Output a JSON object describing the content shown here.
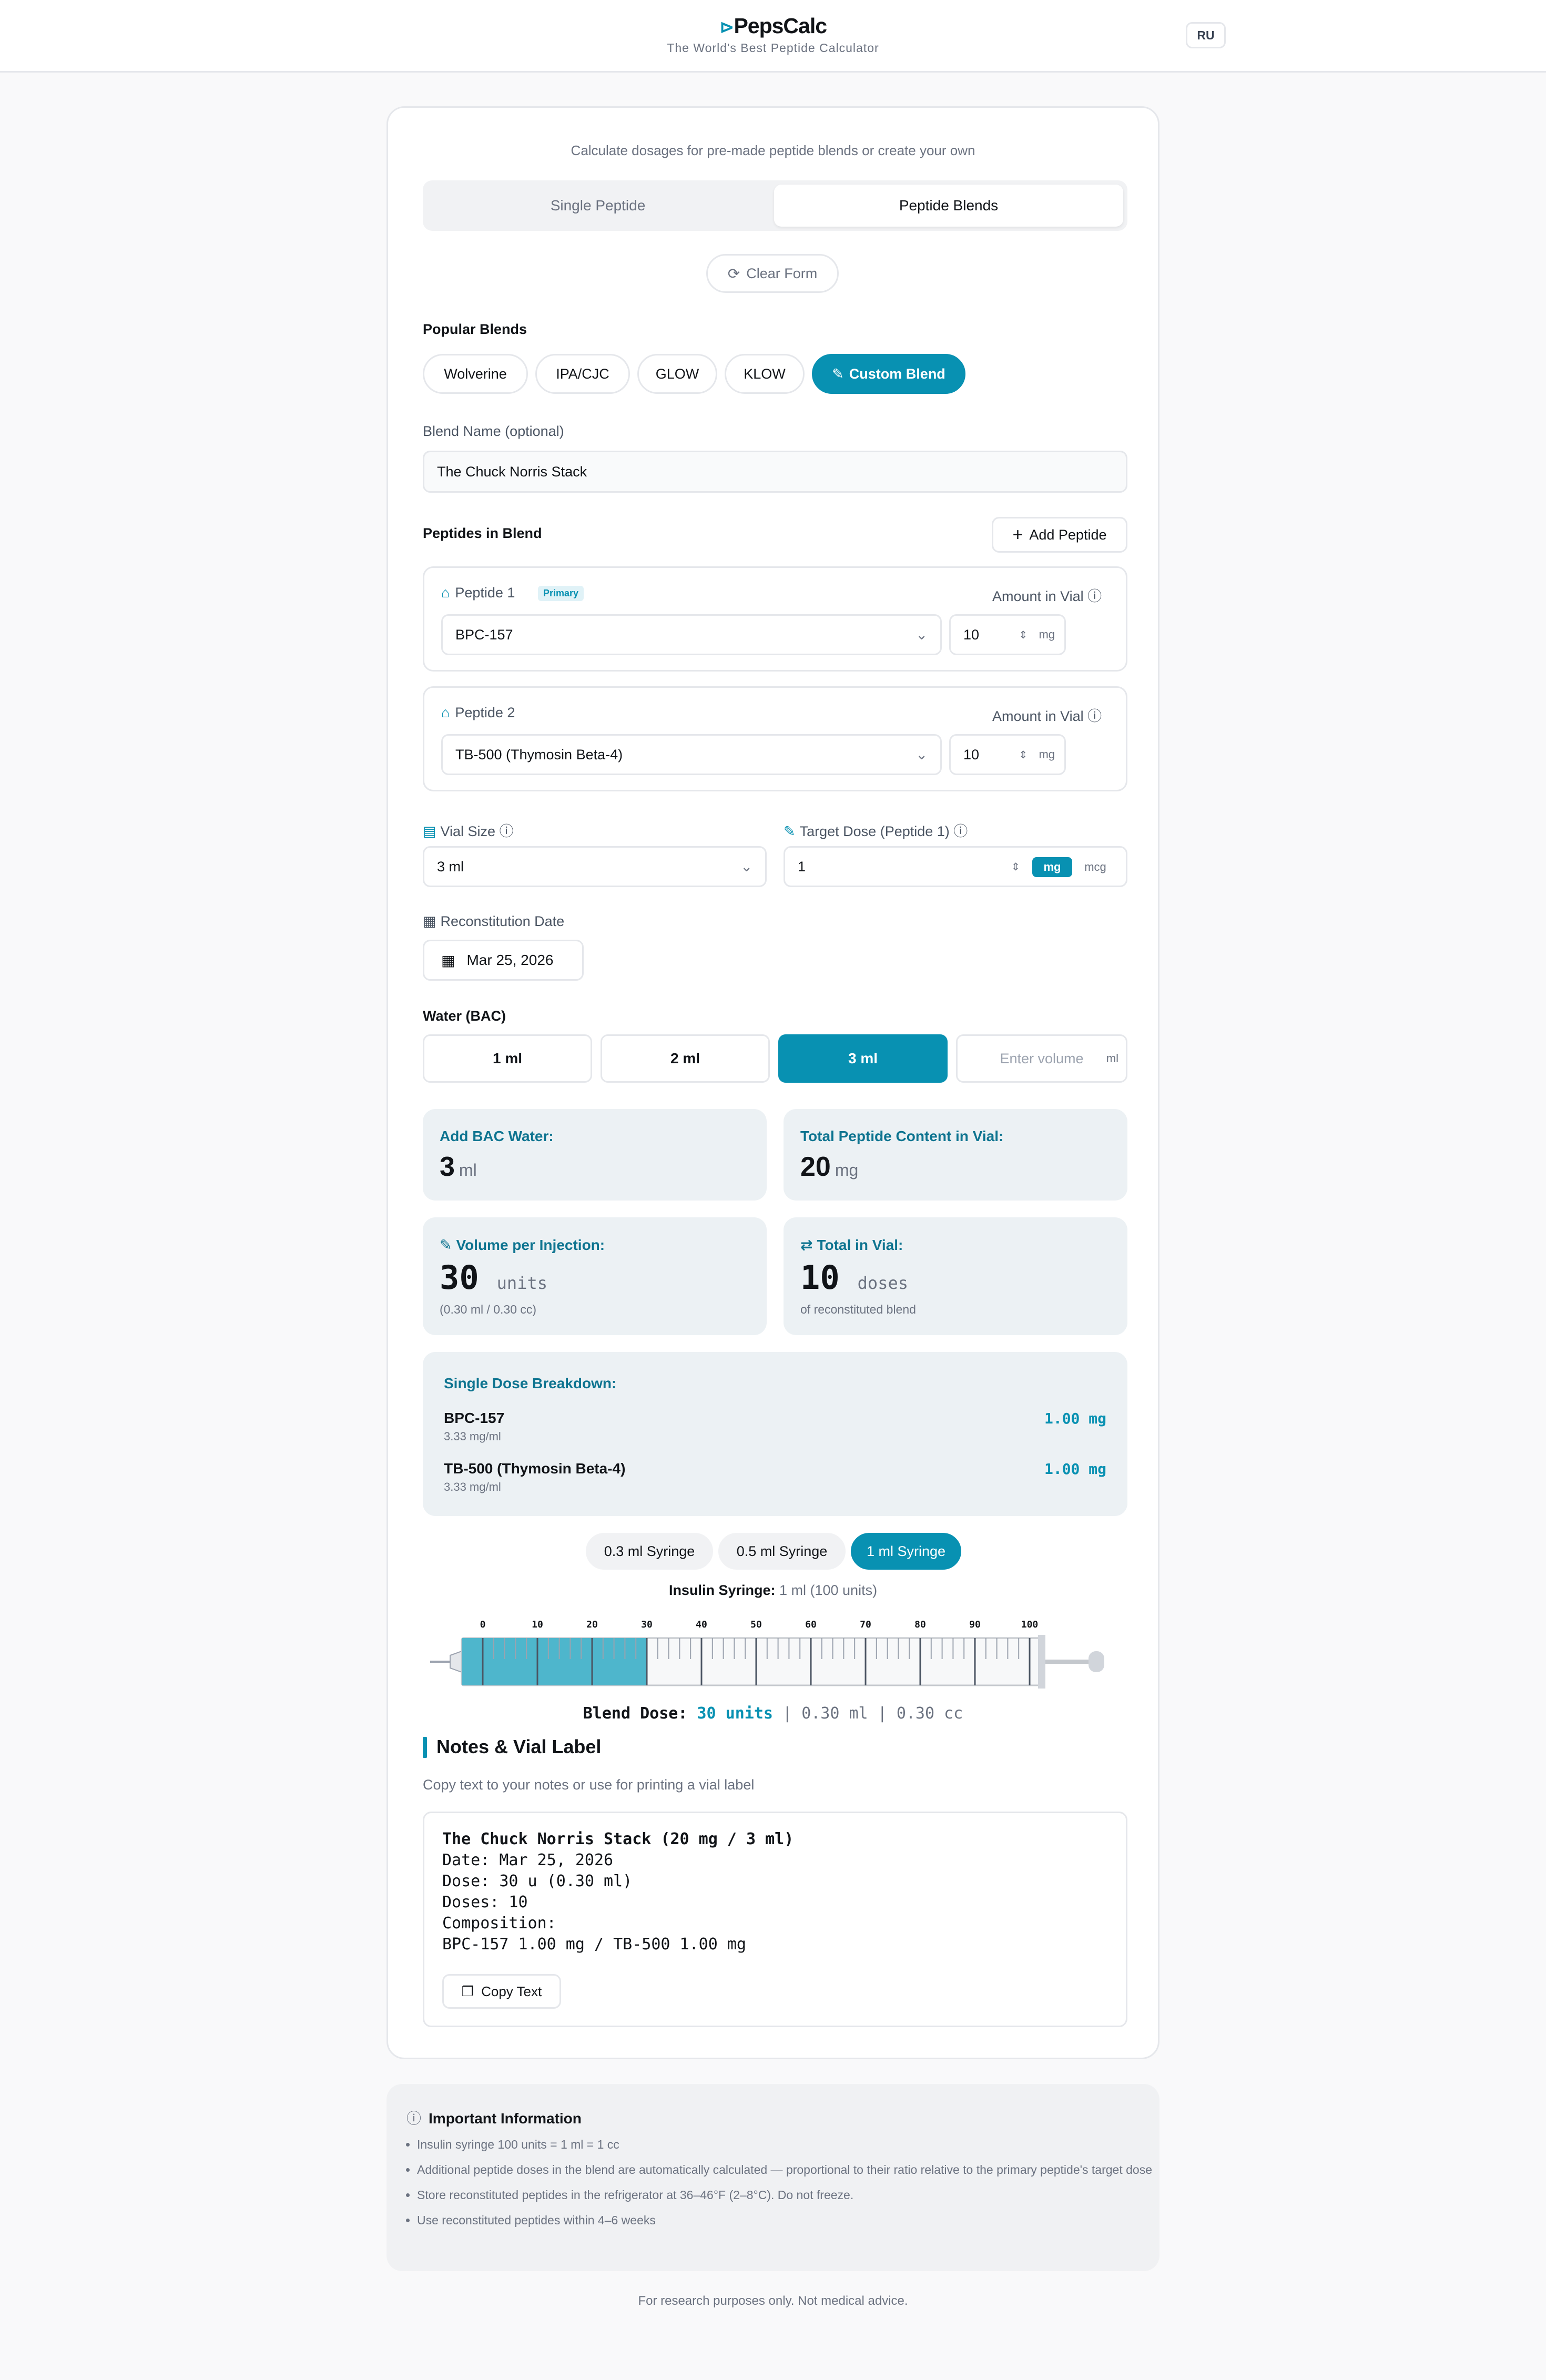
{
  "header": {
    "logo": "PepsCalc",
    "tagline": "The World's Best Peptide Calculator",
    "lang": "RU"
  },
  "intro": "Calculate dosages for pre-made peptide blends or create your own",
  "tabs": [
    {
      "label": "Single Peptide",
      "active": false
    },
    {
      "label": "Peptide Blends",
      "active": true
    }
  ],
  "clear_form": "Clear Form",
  "popular_blends": {
    "label": "Popular Blends",
    "items": [
      "Wolverine",
      "IPA/CJC",
      "GLOW",
      "KLOW"
    ],
    "custom": "Custom Blend"
  },
  "blend_name": {
    "label": "Blend Name (optional)",
    "value": "The Chuck Norris Stack"
  },
  "peptides": {
    "label": "Peptides in Blend",
    "add_button": "Add Peptide",
    "amount_label": "Amount in Vial",
    "primary_badge": "Primary",
    "items": [
      {
        "label": "Peptide 1",
        "name": "BPC-157",
        "amount": "10",
        "unit": "mg"
      },
      {
        "label": "Peptide 2",
        "name": "TB-500 (Thymosin Beta-4)",
        "amount": "10",
        "unit": "mg"
      }
    ]
  },
  "vial_size": {
    "label": "Vial Size",
    "value": "3 ml"
  },
  "target_dose": {
    "label": "Target Dose (Peptide 1)",
    "value": "1",
    "units": [
      "mg",
      "mcg"
    ],
    "selected_unit": "mg"
  },
  "reconstitution": {
    "label": "Reconstitution Date",
    "value": "Mar 25, 2026"
  },
  "water": {
    "label": "Water (BAC)",
    "options": [
      "1 ml",
      "2 ml",
      "3 ml"
    ],
    "selected": "3 ml",
    "custom_placeholder": "Enter volume",
    "custom_unit": "ml"
  },
  "results": {
    "bac_water": {
      "label": "Add BAC Water:",
      "value": "3",
      "unit": "ml"
    },
    "total_content": {
      "label": "Total Peptide Content in Vial:",
      "value": "20",
      "unit": "mg"
    },
    "volume": {
      "label": "Volume per Injection:",
      "value": "30",
      "unit": "units",
      "sub": "(0.30 ml / 0.30 cc)"
    },
    "total_vial": {
      "label": "Total in Vial:",
      "value": "10",
      "unit": "doses",
      "sub": "of reconstituted blend"
    }
  },
  "breakdown": {
    "label": "Single Dose Breakdown:",
    "items": [
      {
        "name": "BPC-157",
        "conc": "3.33 mg/ml",
        "dose": "1.00 mg"
      },
      {
        "name": "TB-500 (Thymosin Beta-4)",
        "conc": "3.33 mg/ml",
        "dose": "1.00 mg"
      }
    ]
  },
  "syringes": {
    "options": [
      "0.3 ml Syringe",
      "0.5 ml Syringe",
      "1 ml Syringe"
    ],
    "selected": "1 ml Syringe"
  },
  "syringe_info": {
    "label": "Insulin Syringe:",
    "value": "1 ml (100 units)"
  },
  "syringe_scale": {
    "ticks": [
      "0",
      "10",
      "20",
      "30",
      "40",
      "50",
      "60",
      "70",
      "80",
      "90",
      "100"
    ],
    "fill_units": 30,
    "max_units": 100
  },
  "blend_dose": {
    "label": "Blend Dose:",
    "units": "30 units",
    "ml": "0.30 ml",
    "cc": "0.30 cc",
    "sep": "|"
  },
  "notes": {
    "title": "Notes & Vial Label",
    "subtitle": "Copy text to your notes or use for printing a vial label",
    "lines": [
      "The Chuck Norris Stack (20 mg / 3 ml)",
      "Date: Mar 25, 2026",
      "Dose: 30 u (0.30 ml)",
      "Doses: 10",
      "Composition:",
      "BPC-157 1.00 mg / TB-500 1.00 mg"
    ],
    "copy_button": "Copy Text"
  },
  "important": {
    "title": "Important Information",
    "items": [
      "Insulin syringe 100 units = 1 ml = 1 cc",
      "Additional peptide doses in the blend are automatically calculated — proportional to their ratio relative to the primary peptide's target dose",
      "Store reconstituted peptides in the refrigerator at 36–46°F (2–8°C). Do not freeze.",
      "Use reconstituted peptides within 4–6 weeks"
    ]
  },
  "footer": "For research purposes only. Not medical advice.",
  "colors": {
    "accent": "#0891b2",
    "accent_dark": "#0e7490",
    "result_bg": "#ecf1f4",
    "border": "#e5e7eb"
  }
}
